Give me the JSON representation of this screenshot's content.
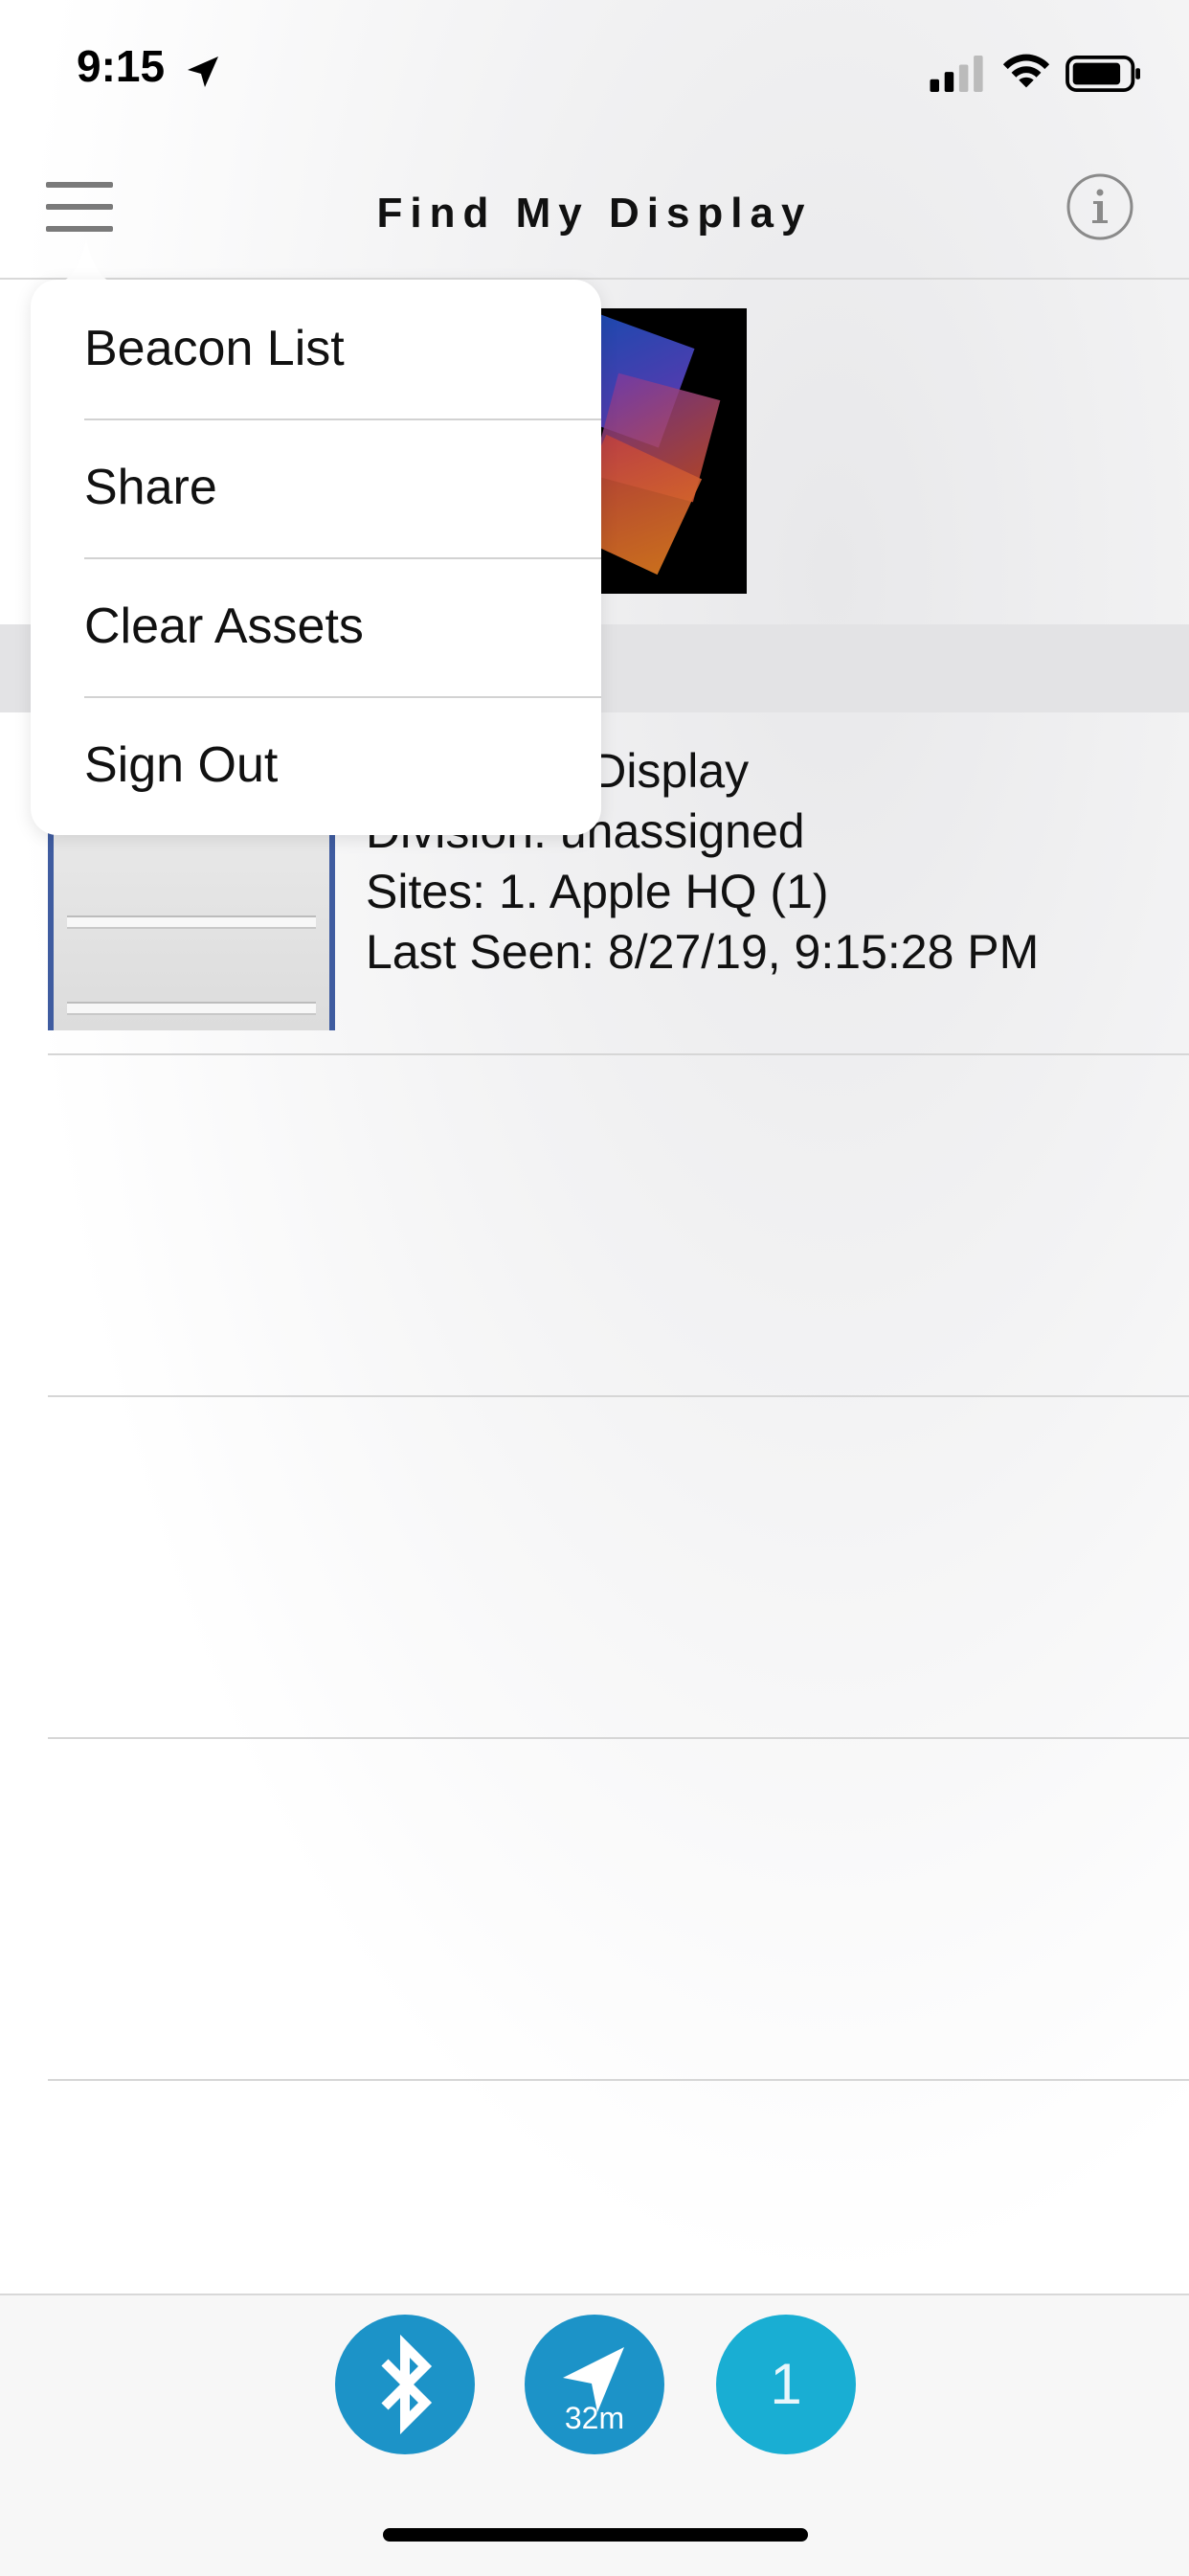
{
  "status_bar": {
    "time": "9:15"
  },
  "nav": {
    "title": "Find My Display"
  },
  "menu": {
    "items": [
      {
        "label": "Beacon List"
      },
      {
        "label": "Share"
      },
      {
        "label": "Clear Assets"
      },
      {
        "label": "Sign Out"
      }
    ]
  },
  "asset": {
    "name_line": "Rocking It Display",
    "division_line": "Division: unassigned",
    "sites_line": "Sites: 1. Apple HQ (1)",
    "last_seen_line": "Last Seen: 8/27/19, 9:15:28 PM"
  },
  "toolbar": {
    "bluetooth_icon": "bluetooth-icon",
    "location_icon": "location-arrow-icon",
    "distance": "32m",
    "count": "1"
  },
  "colors": {
    "accent_blue": "#1c93c8",
    "count_blue": "#19aed3",
    "thumb_frame": "#3f5ca0"
  }
}
